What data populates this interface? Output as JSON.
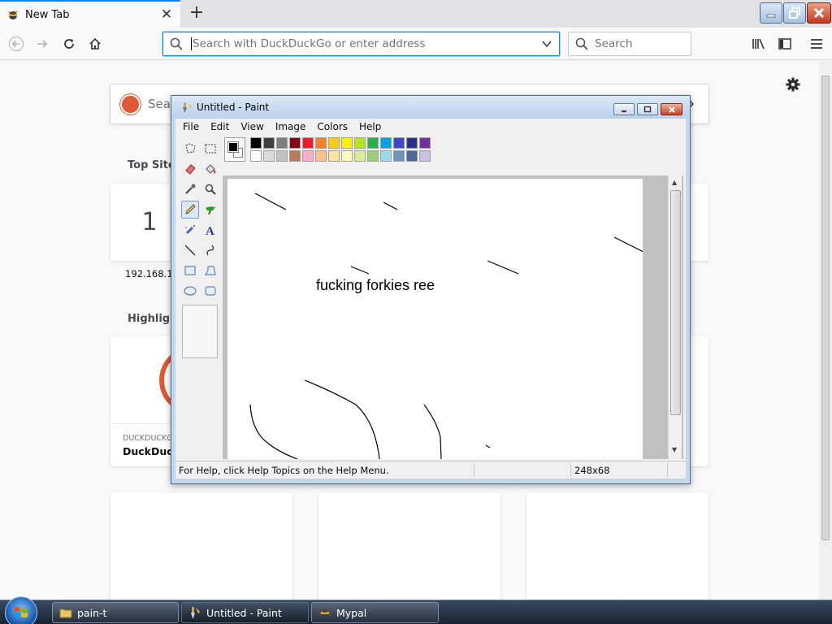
{
  "browser": {
    "tab": {
      "title": "New Tab",
      "favicon": "ninja-icon"
    },
    "urlbar": {
      "placeholder": "Search with DuckDuckGo or enter address"
    },
    "searchbar": {
      "placeholder": "Search"
    }
  },
  "newtab": {
    "search_placeholder": "Sear",
    "top_sites_title": "Top Sites",
    "top_site": {
      "number": "1",
      "label": "192.168.1.1"
    },
    "highlights_title": "Highligh",
    "highlight_card": {
      "source": "DUCKDUCKG",
      "title": "DuckDuck"
    }
  },
  "paint": {
    "title": "Untitled - Paint",
    "menu": [
      "File",
      "Edit",
      "View",
      "Image",
      "Colors",
      "Help"
    ],
    "canvas_text": "fucking forkies ree",
    "status_help": "For Help, click Help Topics on the Help Menu.",
    "status_coords": "248x68",
    "palette_top": [
      "#000000",
      "#404040",
      "#7f7f7f",
      "#880015",
      "#ed1c24",
      "#ff7f27",
      "#ffc90e",
      "#fff200",
      "#b5e61d",
      "#22b14c",
      "#00a2e8",
      "#3f48cc",
      "#28328c",
      "#7030a0"
    ],
    "palette_bottom": [
      "#ffffff",
      "#dcdcdc",
      "#c3c3c3",
      "#b97a57",
      "#ffaec9",
      "#ffc090",
      "#ffe4a0",
      "#fffabc",
      "#d8ec9a",
      "#9bd07a",
      "#99d9ea",
      "#7092be",
      "#4f6898",
      "#c8bfe7"
    ],
    "tools": [
      "free-select-icon",
      "rect-select-icon",
      "eraser-icon",
      "fill-icon",
      "color-picker-icon",
      "magnifier-icon",
      "pencil-icon",
      "brush-icon",
      "airbrush-icon",
      "text-icon",
      "line-icon",
      "curve-icon",
      "rectangle-icon",
      "polygon-icon",
      "ellipse-icon",
      "rounded-rect-icon"
    ]
  },
  "taskbar": {
    "items": [
      {
        "label": "pain-t",
        "icon": "folder-icon"
      },
      {
        "label": "Untitled - Paint",
        "icon": "paint-icon"
      },
      {
        "label": "Mypal",
        "icon": "ninja-icon"
      }
    ]
  }
}
